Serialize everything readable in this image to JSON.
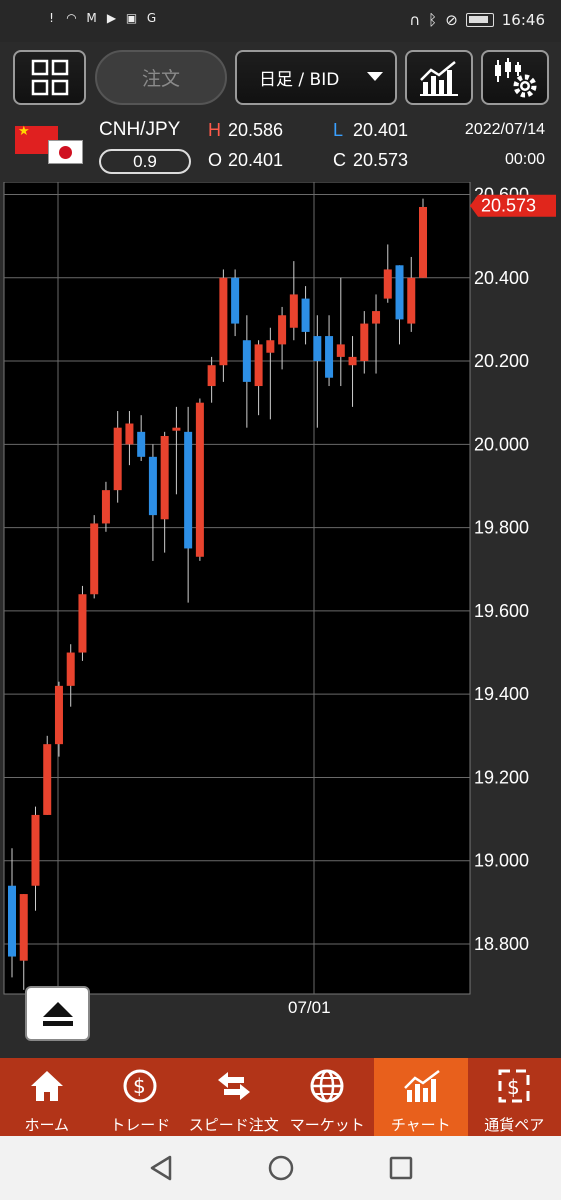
{
  "status_bar": {
    "time": "16:46",
    "left_icons": [
      "alert-icon",
      "wifi-icon",
      "mail-icon",
      "youtube-icon",
      "app-icon",
      "google-icon"
    ],
    "right_icons": [
      "headset-icon",
      "bluetooth-icon",
      "mute-icon",
      "battery-icon"
    ]
  },
  "toolbar": {
    "order_label": "注文",
    "period_label": "日足 / BID"
  },
  "quote": {
    "pair": "CNH/JPY",
    "spread": "0.9",
    "h_key": "H",
    "h_val": "20.586",
    "l_key": "L",
    "l_val": "20.401",
    "o_key": "O",
    "o_val": "20.401",
    "c_key": "C",
    "c_val": "20.573",
    "date": "2022/07/14",
    "time": "00:00"
  },
  "chart_data": {
    "type": "candlestick",
    "y_ticks": [
      "20.600",
      "20.400",
      "20.200",
      "20.000",
      "19.800",
      "19.600",
      "19.400",
      "19.200",
      "19.000",
      "18.800"
    ],
    "ylim": [
      18.68,
      20.63
    ],
    "x_tick_label": "07/01",
    "current_price": "20.573",
    "up_color": "#e8432e",
    "down_color": "#2d8fe6",
    "candles": [
      {
        "o": 18.94,
        "h": 19.03,
        "l": 18.72,
        "c": 18.77
      },
      {
        "o": 18.76,
        "h": 18.92,
        "l": 18.69,
        "c": 18.92
      },
      {
        "o": 18.94,
        "h": 19.13,
        "l": 18.88,
        "c": 19.11
      },
      {
        "o": 19.11,
        "h": 19.3,
        "l": 19.11,
        "c": 19.28
      },
      {
        "o": 19.28,
        "h": 19.43,
        "l": 19.25,
        "c": 19.42
      },
      {
        "o": 19.42,
        "h": 19.52,
        "l": 19.37,
        "c": 19.5
      },
      {
        "o": 19.5,
        "h": 19.66,
        "l": 19.48,
        "c": 19.64
      },
      {
        "o": 19.64,
        "h": 19.83,
        "l": 19.63,
        "c": 19.81
      },
      {
        "o": 19.81,
        "h": 19.91,
        "l": 19.79,
        "c": 19.89
      },
      {
        "o": 19.89,
        "h": 20.08,
        "l": 19.86,
        "c": 20.04
      },
      {
        "o": 20.0,
        "h": 20.08,
        "l": 19.95,
        "c": 20.05
      },
      {
        "o": 20.03,
        "h": 20.07,
        "l": 19.96,
        "c": 19.97
      },
      {
        "o": 19.97,
        "h": 20.0,
        "l": 19.72,
        "c": 19.83
      },
      {
        "o": 19.82,
        "h": 20.03,
        "l": 19.74,
        "c": 20.02
      },
      {
        "o": 20.04,
        "h": 20.09,
        "l": 19.88,
        "c": 20.04
      },
      {
        "o": 20.03,
        "h": 20.09,
        "l": 19.62,
        "c": 19.75
      },
      {
        "o": 19.73,
        "h": 20.11,
        "l": 19.72,
        "c": 20.1
      },
      {
        "o": 20.14,
        "h": 20.21,
        "l": 20.1,
        "c": 20.19
      },
      {
        "o": 20.19,
        "h": 20.42,
        "l": 20.15,
        "c": 20.4
      },
      {
        "o": 20.4,
        "h": 20.42,
        "l": 20.26,
        "c": 20.29
      },
      {
        "o": 20.25,
        "h": 20.31,
        "l": 20.04,
        "c": 20.15
      },
      {
        "o": 20.14,
        "h": 20.25,
        "l": 20.07,
        "c": 20.24
      },
      {
        "o": 20.22,
        "h": 20.28,
        "l": 20.06,
        "c": 20.25
      },
      {
        "o": 20.24,
        "h": 20.33,
        "l": 20.18,
        "c": 20.31
      },
      {
        "o": 20.28,
        "h": 20.44,
        "l": 20.25,
        "c": 20.36
      },
      {
        "o": 20.35,
        "h": 20.38,
        "l": 20.24,
        "c": 20.27
      },
      {
        "o": 20.26,
        "h": 20.31,
        "l": 20.04,
        "c": 20.2
      },
      {
        "o": 20.26,
        "h": 20.31,
        "l": 20.14,
        "c": 20.16
      },
      {
        "o": 20.21,
        "h": 20.4,
        "l": 20.14,
        "c": 20.24
      },
      {
        "o": 20.19,
        "h": 20.26,
        "l": 20.09,
        "c": 20.21
      },
      {
        "o": 20.2,
        "h": 20.32,
        "l": 20.17,
        "c": 20.29
      },
      {
        "o": 20.29,
        "h": 20.36,
        "l": 20.17,
        "c": 20.32
      },
      {
        "o": 20.35,
        "h": 20.48,
        "l": 20.34,
        "c": 20.42
      },
      {
        "o": 20.43,
        "h": 20.43,
        "l": 20.24,
        "c": 20.3
      },
      {
        "o": 20.29,
        "h": 20.45,
        "l": 20.27,
        "c": 20.4
      },
      {
        "o": 20.4,
        "h": 20.59,
        "l": 20.4,
        "c": 20.57
      }
    ]
  },
  "bottom_nav": [
    {
      "label": "ホーム",
      "icon": "home-icon",
      "active": false
    },
    {
      "label": "トレード",
      "icon": "trade-icon",
      "active": false
    },
    {
      "label": "スピード注文",
      "icon": "speed-order-icon",
      "active": false
    },
    {
      "label": "マーケット",
      "icon": "market-globe-icon",
      "active": false
    },
    {
      "label": "チャート",
      "icon": "chart-icon",
      "active": true
    },
    {
      "label": "通貨ペア",
      "icon": "currency-pair-icon",
      "active": false
    }
  ]
}
